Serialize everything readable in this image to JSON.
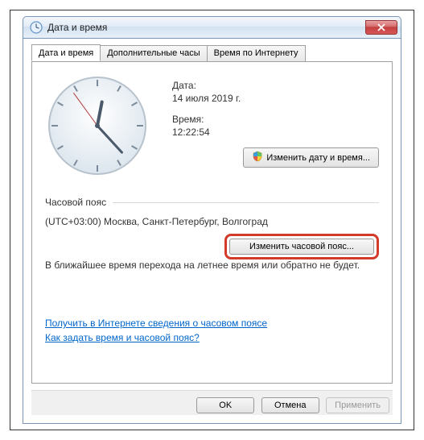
{
  "window": {
    "title": "Дата и время"
  },
  "tabs": [
    {
      "label": "Дата и время",
      "active": true
    },
    {
      "label": "Дополнительные часы",
      "active": false
    },
    {
      "label": "Время по Интернету",
      "active": false
    }
  ],
  "datetime": {
    "date_label": "Дата:",
    "date_value": "14 июля 2019 г.",
    "time_label": "Время:",
    "time_value": "12:22:54",
    "change_button": "Изменить дату и время..."
  },
  "timezone": {
    "section_label": "Часовой пояс",
    "value": "(UTC+03:00) Москва, Санкт-Петербург, Волгоград",
    "change_button": "Изменить часовой пояс...",
    "dst_notice": "В ближайшее время перехода на летнее время или обратно не будет."
  },
  "links": {
    "tz_info": "Получить в Интернете сведения о часовом поясе",
    "howto": "Как задать время и часовой пояс?"
  },
  "footer": {
    "ok": "OK",
    "cancel": "Отмена",
    "apply": "Применить"
  },
  "clock": {
    "hour": 12,
    "minute": 22,
    "second": 54
  }
}
